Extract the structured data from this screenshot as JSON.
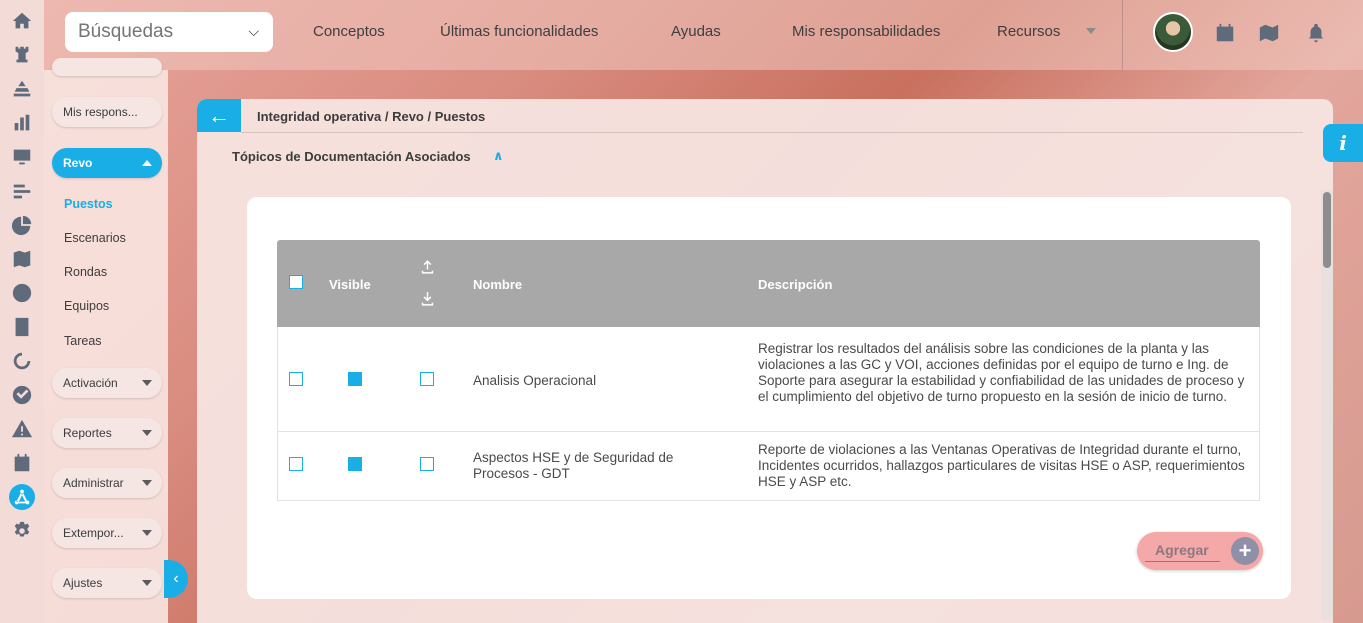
{
  "rail": {
    "icons": [
      "home-icon",
      "chess-rook-icon",
      "layers-icon",
      "bar-chart-icon",
      "monitor-icon",
      "filter-bars-icon",
      "pie-chart-icon",
      "map-icon",
      "clock-icon",
      "list-icon",
      "cycle-icon",
      "check-circle-icon",
      "warning-icon",
      "calendar-icon",
      "network-icon",
      "gear-icon"
    ],
    "active": "network-icon"
  },
  "topbar": {
    "search_label": "Búsquedas",
    "nav": [
      "Conceptos",
      "Últimas funcionalidades",
      "Ayudas",
      "Mis responsabilidades",
      "Recursos"
    ]
  },
  "sidebar": {
    "mis_respons": "Mis respons...",
    "revo": "Revo",
    "sub_items": [
      "Puestos",
      "Escenarios",
      "Rondas",
      "Equipos",
      "Tareas"
    ],
    "active_sub": "Puestos",
    "groups": [
      "Activación",
      "Reportes",
      "Administrar",
      "Extempor...",
      "Ajustes"
    ]
  },
  "panel": {
    "breadcrumb": "Integridad operativa / Revo / Puestos",
    "section_title": "Tópicos de Documentación Asociados",
    "table": {
      "headers": {
        "visible": "Visible",
        "nombre": "Nombre",
        "descripcion": "Descripción"
      },
      "rows": [
        {
          "selected": false,
          "visible": true,
          "exported": false,
          "nombre": "Analisis Operacional",
          "descripcion": "Registrar los resultados del análisis sobre las condiciones de la planta y las violaciones a las GC y VOI, acciones definidas por el equipo de turno e Ing. de Soporte para asegurar la estabilidad y confiabilidad de las unidades de proceso y el cumplimiento del objetivo de turno propuesto en la sesión de inicio de turno."
        },
        {
          "selected": false,
          "visible": true,
          "exported": false,
          "nombre": "Aspectos HSE y de Seguridad de Procesos - GDT",
          "descripcion": "Reporte de violaciones a las Ventanas Operativas de Integridad durante el turno, Incidentes ocurridos, hallazgos particulares de visitas HSE o ASP, requerimientos HSE y ASP etc."
        }
      ]
    },
    "add_button": "Agregar"
  },
  "colors": {
    "accent": "#19aee6",
    "header_gray": "#a8a8a8",
    "add_button": "#f5a8a8"
  }
}
